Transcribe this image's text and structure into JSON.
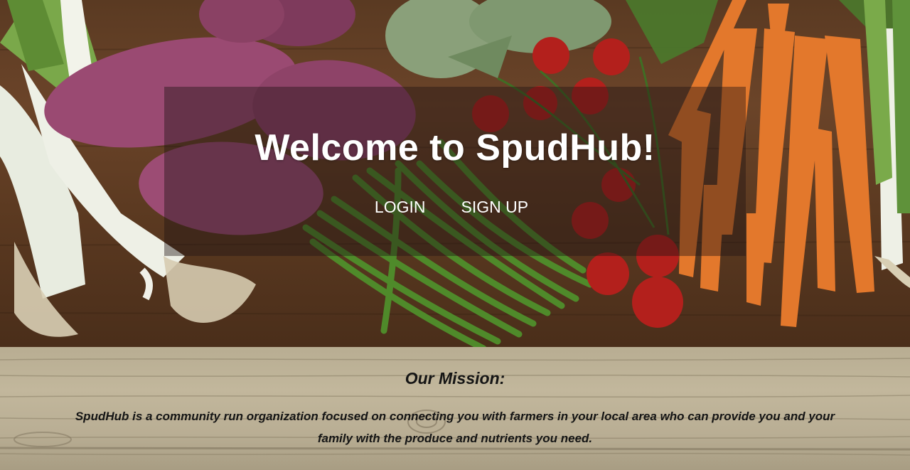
{
  "hero": {
    "title": "Welcome to SpudHub!",
    "nav": {
      "login_label": "LOGIN",
      "signup_label": "SIGN UP"
    },
    "background_image": "vegetables-on-wood-photo"
  },
  "mission": {
    "heading": "Our Mission:",
    "body": "SpudHub is a community run organization focused on connecting you with farmers in your local area who can provide you and your family with the produce and nutrients you need.",
    "background_image": "light-wood-texture"
  },
  "colors": {
    "hero_text": "#ffffff",
    "overlay": "rgba(30,20,20,0.42)",
    "mission_bg": "#bdb298",
    "mission_text": "#151515"
  }
}
